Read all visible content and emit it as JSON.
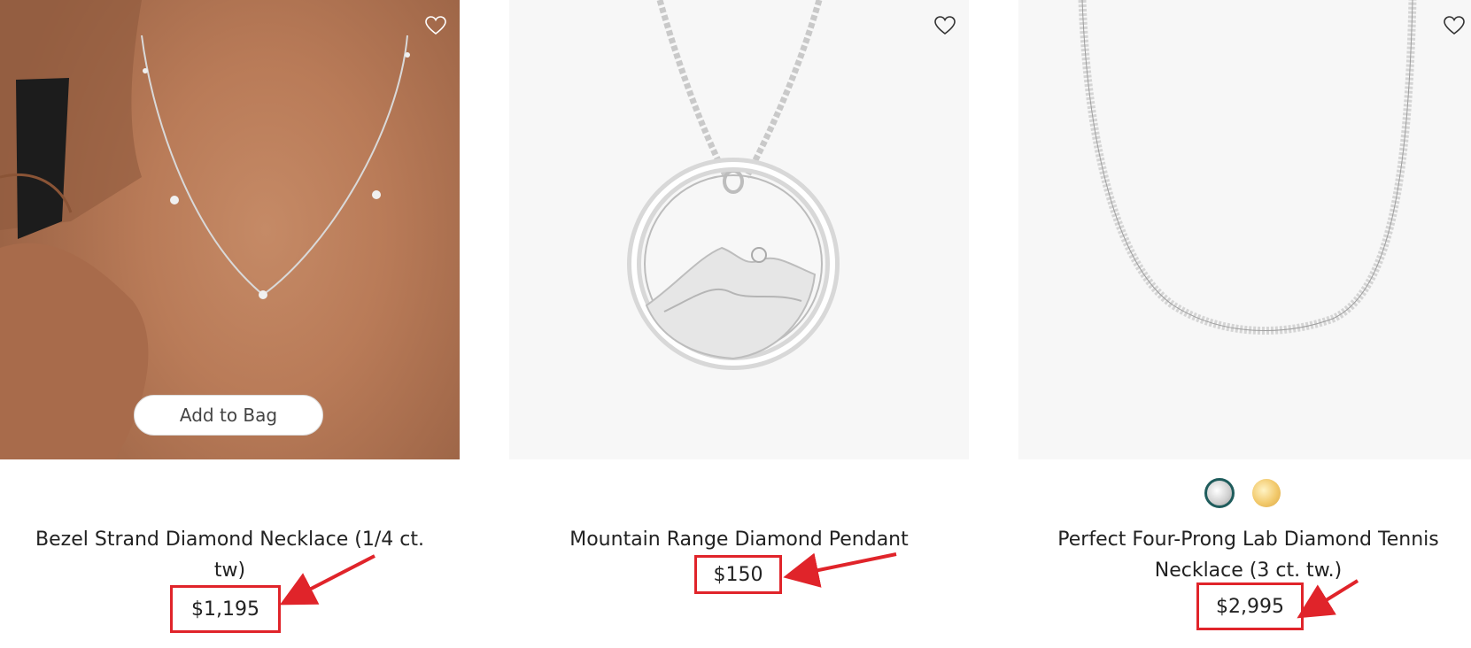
{
  "products": [
    {
      "title": "Bezel Strand Diamond Necklace (1/4 ct. tw)",
      "price": "$1,195",
      "add_to_bag": "Add to Bag",
      "favorite_icon": "heart-icon"
    },
    {
      "title": "Mountain Range Diamond Pendant",
      "price": "$150",
      "favorite_icon": "heart-icon"
    },
    {
      "title": "Perfect Four-Prong Lab Diamond Tennis Necklace (3 ct. tw.)",
      "price": "$2,995",
      "favorite_icon": "heart-icon",
      "swatches": [
        "white-gold",
        "yellow-gold"
      ]
    }
  ],
  "annotation": {
    "color": "#e0242a",
    "type": "red-box-and-arrow"
  }
}
